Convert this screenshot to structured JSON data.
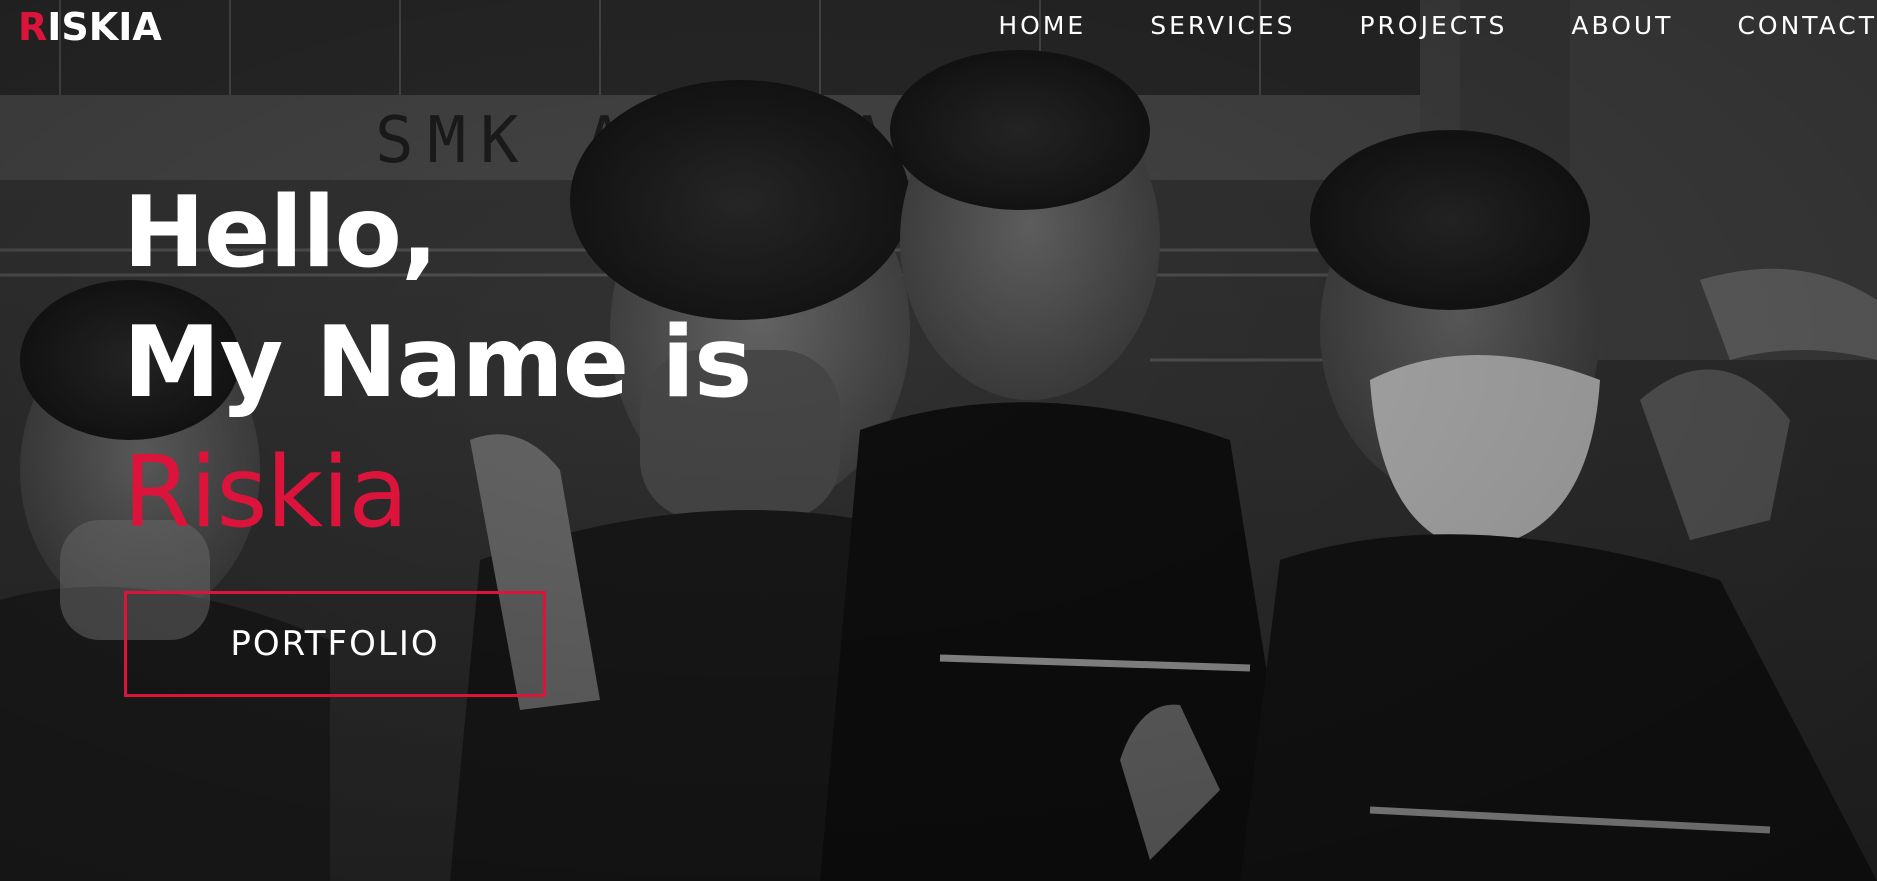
{
  "brand": {
    "logo_first_letter": "R",
    "logo_rest": "ISKIA",
    "accent_color": "#dc143c"
  },
  "nav": {
    "items": [
      {
        "label": "HOME"
      },
      {
        "label": "SERVICES"
      },
      {
        "label": "PROJECTS"
      },
      {
        "label": "ABOUT"
      },
      {
        "label": "CONTACT"
      }
    ]
  },
  "hero": {
    "line1": "Hello,",
    "line2": "My Name is",
    "name": "Riskia",
    "cta_label": "PORTFOLIO",
    "background": "grayscale group photo",
    "background_sign_text": "SMK AIR PAPAN"
  }
}
